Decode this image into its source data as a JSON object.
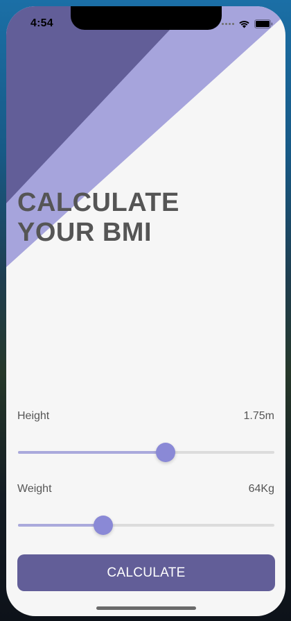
{
  "status_bar": {
    "time": "4:54",
    "icons": [
      "signal-dots-icon",
      "wifi-icon",
      "battery-icon"
    ]
  },
  "colors": {
    "dark_purple": "#625e98",
    "light_purple": "#a6a4dc",
    "thumb": "#8a89d6",
    "background": "#f6f6f6",
    "text": "#555555"
  },
  "header": {
    "title_line1": "CALCULATE",
    "title_line2": "YOUR BMI"
  },
  "height": {
    "label": "Height",
    "value": "1.75m",
    "slider_fraction": 0.577
  },
  "weight": {
    "label": "Weight",
    "value": "64Kg",
    "slider_fraction": 0.332
  },
  "calculate_button": {
    "label": "CALCULATE"
  }
}
